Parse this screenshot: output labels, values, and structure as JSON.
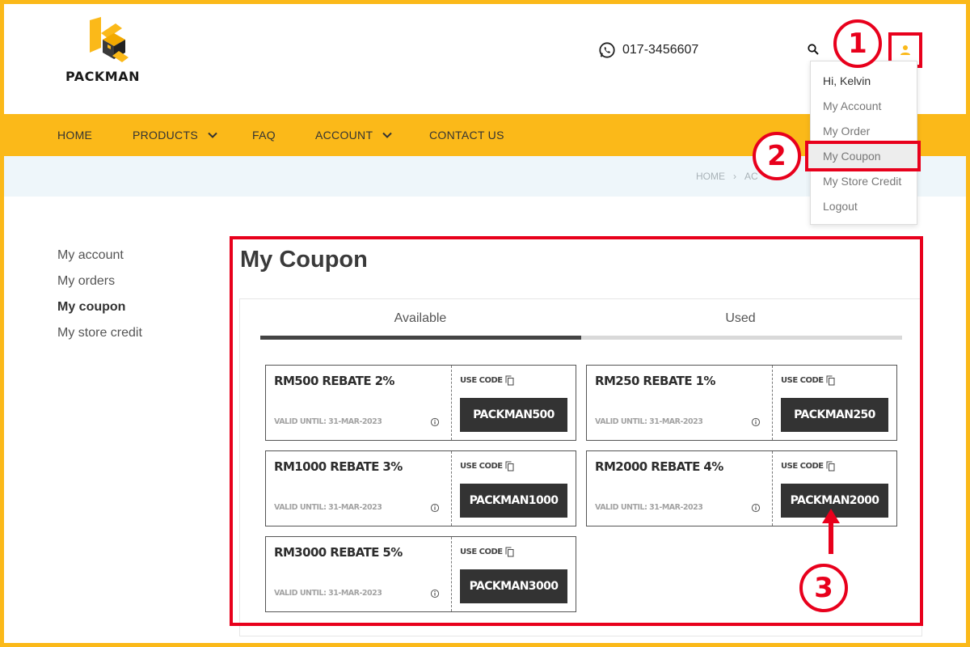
{
  "brand": {
    "name": "PACKMAN",
    "accent": "#fbb919",
    "annotation_color": "#e8001c"
  },
  "header": {
    "phone": "017-3456607",
    "search_icon": "search-icon",
    "user_icon": "user-icon"
  },
  "nav": {
    "items": [
      {
        "label": "HOME",
        "has_dropdown": false
      },
      {
        "label": "PRODUCTS",
        "has_dropdown": true
      },
      {
        "label": "FAQ",
        "has_dropdown": false
      },
      {
        "label": "ACCOUNT",
        "has_dropdown": true
      },
      {
        "label": "CONTACT US",
        "has_dropdown": false
      }
    ]
  },
  "breadcrumb": {
    "items": [
      "HOME",
      "AC"
    ]
  },
  "user_menu": {
    "greeting": "Hi, Kelvin",
    "items": [
      "My Account",
      "My Order",
      "My Coupon",
      "My Store Credit",
      "Logout"
    ],
    "highlighted": "My Coupon"
  },
  "sidebar": {
    "items": [
      "My account",
      "My orders",
      "My coupon",
      "My store credit"
    ],
    "active": "My coupon"
  },
  "main": {
    "title": "My Coupon",
    "tabs": [
      {
        "label": "Available",
        "active": true
      },
      {
        "label": "Used",
        "active": false
      }
    ]
  },
  "coupons": [
    {
      "title": "RM500 REBATE 2%",
      "valid": "VALID UNTIL: 31-MAR-2023",
      "use_label": "USE CODE",
      "code": "PACKMAN500"
    },
    {
      "title": "RM250 REBATE 1%",
      "valid": "VALID UNTIL: 31-MAR-2023",
      "use_label": "USE CODE",
      "code": "PACKMAN250"
    },
    {
      "title": "RM1000 REBATE 3%",
      "valid": "VALID UNTIL: 31-MAR-2023",
      "use_label": "USE CODE",
      "code": "PACKMAN1000"
    },
    {
      "title": "RM2000 REBATE 4%",
      "valid": "VALID UNTIL: 31-MAR-2023",
      "use_label": "USE CODE",
      "code": "PACKMAN2000"
    },
    {
      "title": "RM3000 REBATE 5%",
      "valid": "VALID UNTIL: 31-MAR-2023",
      "use_label": "USE CODE",
      "code": "PACKMAN3000"
    }
  ],
  "annotations": [
    "1",
    "2",
    "3"
  ]
}
